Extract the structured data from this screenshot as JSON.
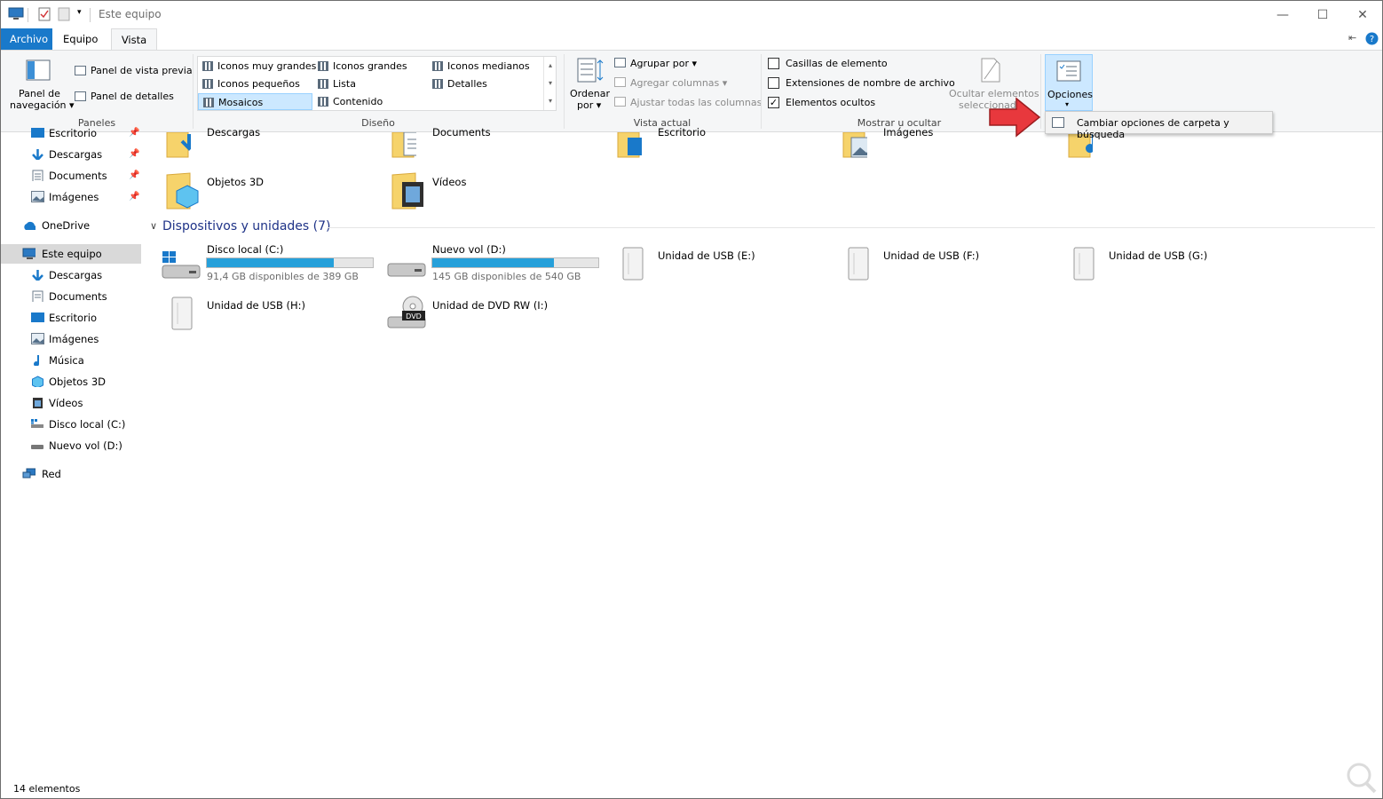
{
  "window": {
    "title": "Este equipo"
  },
  "tabs": {
    "archivo": "Archivo",
    "equipo": "Equipo",
    "vista": "Vista"
  },
  "ribbon": {
    "paneles": {
      "label": "Paneles",
      "nav_pane": [
        "Panel de",
        "navegación"
      ],
      "preview": "Panel de vista previa",
      "details": "Panel de detalles"
    },
    "diseno": {
      "label": "Diseño",
      "items": [
        "Iconos muy grandes",
        "Iconos grandes",
        "Iconos medianos",
        "Iconos pequeños",
        "Lista",
        "Detalles",
        "Mosaicos",
        "Contenido"
      ]
    },
    "vista_actual": {
      "label": "Vista actual",
      "sort": [
        "Ordenar",
        "por"
      ],
      "group_by": "Agrupar por",
      "add_columns": "Agregar columnas",
      "fit_columns": "Ajustar todas las columnas"
    },
    "mostrar": {
      "label": "Mostrar u ocultar",
      "checkboxes": "Casillas de elemento",
      "extensions": "Extensiones de nombre de archivo",
      "hidden": "Elementos ocultos",
      "hide_selected": [
        "Ocultar elementos",
        "seleccionad"
      ]
    },
    "opciones": {
      "label": "Opciones",
      "menu_item": "Cambiar opciones de carpeta y búsqueda"
    }
  },
  "nav": {
    "quick": [
      "Escritorio",
      "Descargas",
      "Documents",
      "Imágenes"
    ],
    "onedrive": "OneDrive",
    "this_pc": "Este equipo",
    "pc_items": [
      "Descargas",
      "Documents",
      "Escritorio",
      "Imágenes",
      "Música",
      "Objetos 3D",
      "Vídeos",
      "Disco local (C:)",
      "Nuevo vol (D:)"
    ],
    "network": "Red"
  },
  "content": {
    "folders": [
      "Descargas",
      "Documents",
      "Escritorio",
      "Imágenes",
      "Objetos 3D",
      "Vídeos"
    ],
    "devices_title": "Dispositivos y unidades (7)",
    "drives": [
      {
        "name": "Disco local (C:)",
        "free": "91,4 GB disponibles de 389 GB",
        "used_fraction": 0.765
      },
      {
        "name": "Nuevo vol (D:)",
        "free": "145 GB disponibles de 540 GB",
        "used_fraction": 0.731
      },
      {
        "name": "Unidad de USB (E:)"
      },
      {
        "name": "Unidad de USB (F:)"
      },
      {
        "name": "Unidad de USB (G:)"
      },
      {
        "name": "Unidad de USB (H:)"
      },
      {
        "name": "Unidad de DVD RW (I:)"
      }
    ]
  },
  "status": {
    "count": "14 elementos"
  },
  "colors": {
    "accent": "#1979ca",
    "drive_bar": "#26a0da",
    "selection": "#cce8ff",
    "arrow": "#e8383d"
  }
}
